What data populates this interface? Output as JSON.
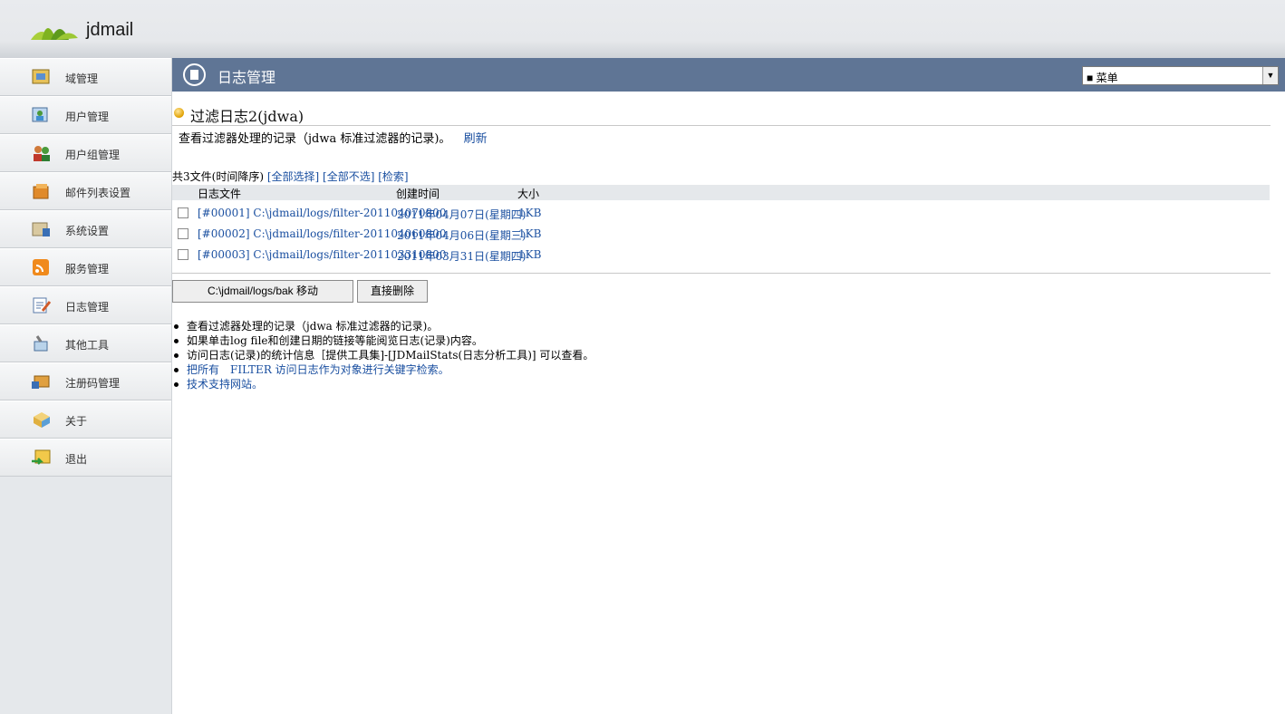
{
  "app": {
    "name": "jdmail"
  },
  "sidebar": {
    "items": [
      {
        "label": "域管理",
        "icon": "domain-icon"
      },
      {
        "label": "用户管理",
        "icon": "user-icon"
      },
      {
        "label": "用户组管理",
        "icon": "user-group-icon"
      },
      {
        "label": "邮件列表设置",
        "icon": "mailing-list-icon"
      },
      {
        "label": "系统设置",
        "icon": "system-settings-icon"
      },
      {
        "label": "服务管理",
        "icon": "rss-service-icon"
      },
      {
        "label": "日志管理",
        "icon": "log-icon"
      },
      {
        "label": "其他工具",
        "icon": "tools-icon"
      },
      {
        "label": "注册码管理",
        "icon": "license-icon"
      },
      {
        "label": "关于",
        "icon": "about-box-icon"
      },
      {
        "label": "退出",
        "icon": "logout-icon"
      }
    ]
  },
  "header": {
    "title": "日志管理",
    "menu_select": "■ 菜单"
  },
  "content": {
    "title": "过滤日志2(jdwa)",
    "description": "查看过滤器处理的记录（jdwa 标准过滤器的记录)。",
    "refresh_label": "刷新",
    "summary": {
      "count_text": "共3文件(时间降序)",
      "select_all": "[全部选择]",
      "deselect_all": "[全部不选]",
      "search": "[检索]"
    },
    "table": {
      "headers": [
        "日志文件",
        "创建时间",
        "大小"
      ],
      "rows": [
        {
          "file": "[#00001] C:\\jdmail/logs/filter-201104070800",
          "created": "2011年04月07日(星期四)",
          "size": "1KB"
        },
        {
          "file": "[#00002] C:\\jdmail/logs/filter-201104060800",
          "created": "2011年04月06日(星期三)",
          "size": "1KB"
        },
        {
          "file": "[#00003] C:\\jdmail/logs/filter-201103310800",
          "created": "2011年03月31日(星期四)",
          "size": "1KB"
        }
      ]
    },
    "buttons": {
      "move": "C:\\jdmail/logs/bak 移动",
      "delete": "直接删除"
    },
    "notes": [
      "查看过滤器处理的记录（jdwa 标准过滤器的记录)。",
      "如果单击log file和创建日期的链接等能阅览日志(记录)内容。",
      "访问日志(记录)的统计信息［提供工具集]-[JDMailStats(日志分析工具)] 可以查看。",
      "把所有　FILTER 访问日志作为对象进行关键字检索。",
      "技术支持网站。"
    ]
  },
  "colors": {
    "header_bg": "#5f7595",
    "link": "#1a4fa0",
    "sidebar_bg": "#e5e8eb"
  }
}
